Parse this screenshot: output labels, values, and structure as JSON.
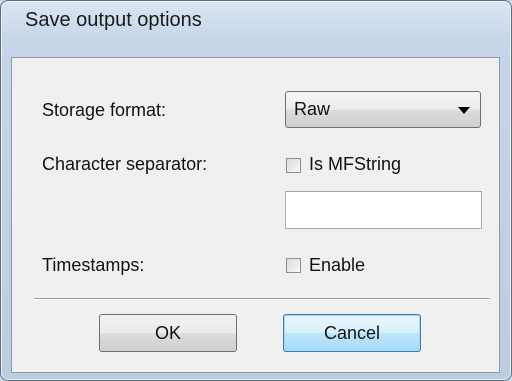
{
  "dialog": {
    "title": "Save output options",
    "storage_format": {
      "label": "Storage format:",
      "selected": "Raw"
    },
    "character_separator": {
      "label": "Character separator:",
      "checkbox_label": "Is MFString",
      "checked": false,
      "value": ""
    },
    "timestamps": {
      "label": "Timestamps:",
      "checkbox_label": "Enable",
      "checked": false
    },
    "buttons": {
      "ok": "OK",
      "cancel": "Cancel"
    }
  }
}
